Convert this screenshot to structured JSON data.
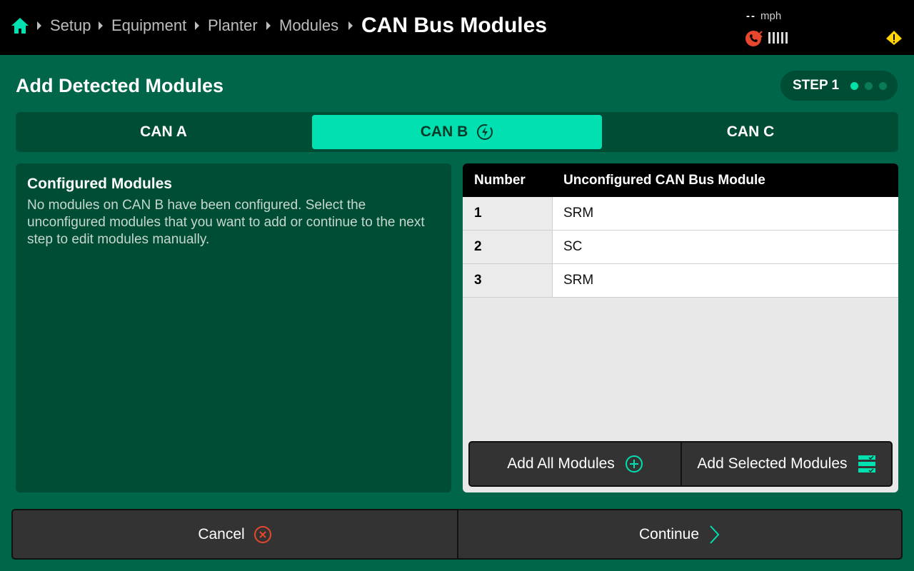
{
  "header": {
    "breadcrumbs": [
      "Setup",
      "Equipment",
      "Planter",
      "Modules"
    ],
    "title": "CAN Bus Modules",
    "speed_value": "--",
    "speed_unit": "mph",
    "icons": {
      "home": "home-icon",
      "phone": "phone-disconnected-icon",
      "signal": "signal-bars-icon",
      "warning": "warning-icon"
    }
  },
  "section": {
    "title": "Add Detected Modules",
    "step_label": "STEP 1",
    "steps_total": 3,
    "step_current": 1
  },
  "tabs": [
    {
      "label": "CAN A",
      "active": false
    },
    {
      "label": "CAN B",
      "active": true
    },
    {
      "label": "CAN C",
      "active": false
    }
  ],
  "configured": {
    "title": "Configured Modules",
    "description": "No modules on CAN B have been configured. Select the unconfigured modules that you want to add or continue to the next step to edit modules manually."
  },
  "table": {
    "headers": [
      "Number",
      "Unconfigured CAN Bus Module"
    ],
    "rows": [
      {
        "number": "1",
        "module": "SRM"
      },
      {
        "number": "2",
        "module": "SC"
      },
      {
        "number": "3",
        "module": "SRM"
      }
    ]
  },
  "actions": {
    "add_all": "Add All Modules",
    "add_selected": "Add Selected Modules"
  },
  "footer": {
    "cancel": "Cancel",
    "continue": "Continue"
  },
  "colors": {
    "background": "#00664a",
    "panel": "#004d36",
    "accent": "#00e0b0",
    "cancel_red": "#e8472e"
  }
}
